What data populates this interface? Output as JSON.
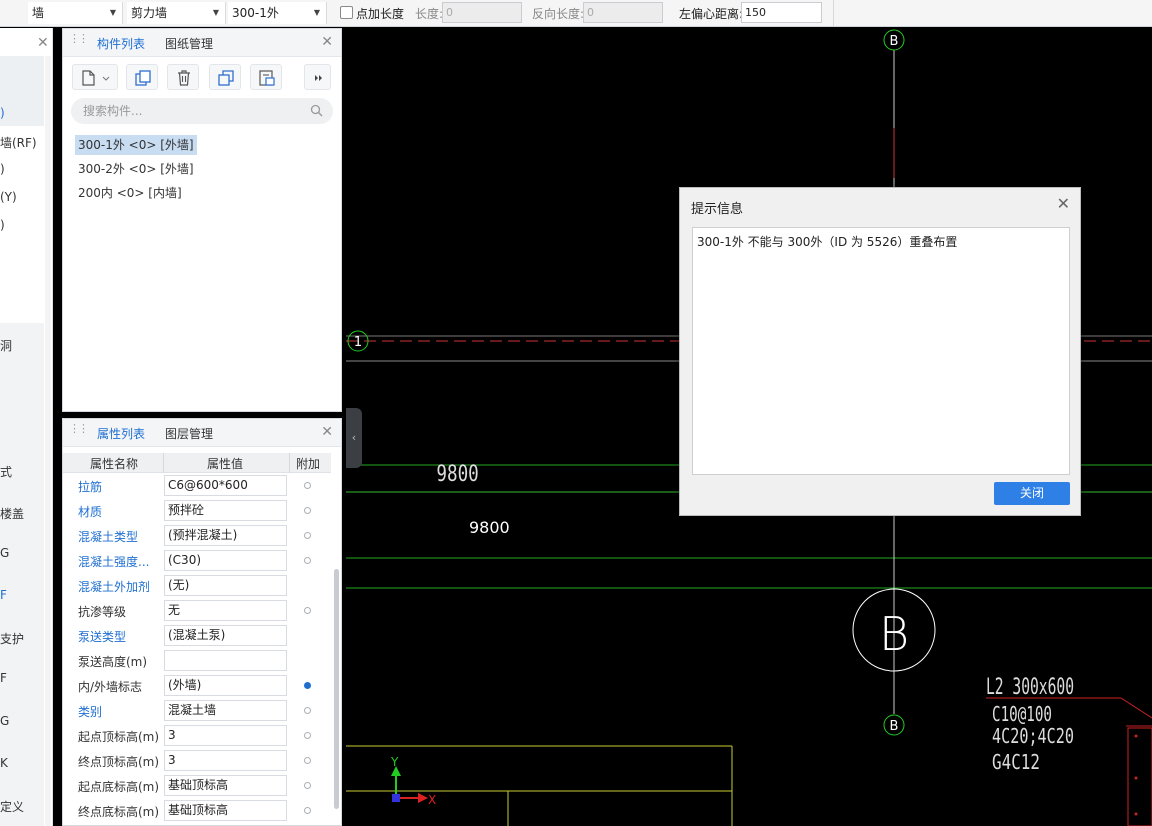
{
  "toolbar": {
    "category": "墙",
    "wall_type": "剪力墙",
    "component": "300-1外",
    "add_length_label": "点加长度",
    "length_label": "长度:",
    "length_value": "0",
    "reverse_length_label": "反向长度:",
    "reverse_length_value": "0",
    "left_offset_label": "左偏心距离:",
    "left_offset_value": "150"
  },
  "left_edge": {
    "items": [
      ")",
      "墙(RF)",
      ")",
      "(Y)",
      ")",
      "洞",
      "式",
      "楼盖",
      "G",
      "F",
      "支护",
      "F",
      "G",
      "K",
      "定义"
    ]
  },
  "component_panel": {
    "tab_list": "构件列表",
    "tab_drawings": "图纸管理",
    "search_placeholder": "搜索构件...",
    "items": [
      "300-1外 <0> [外墙]",
      "300-2外 <0> [外墙]",
      "200内 <0> [内墙]"
    ]
  },
  "property_panel": {
    "tab_props": "属性列表",
    "tab_layers": "图层管理",
    "col_name": "属性名称",
    "col_value": "属性值",
    "col_extra": "附加",
    "rows": [
      {
        "name": "拉筋",
        "value": "C6@600*600"
      },
      {
        "name": "材质",
        "value": "预拌砼"
      },
      {
        "name": "混凝土类型",
        "value": "(预拌混凝土)"
      },
      {
        "name": "混凝土强度...",
        "value": "(C30)"
      },
      {
        "name": "混凝土外加剂",
        "value": "(无)"
      },
      {
        "name": "抗渗等级",
        "value": "无"
      },
      {
        "name": "泵送类型",
        "value": "(混凝土泵)"
      },
      {
        "name": "泵送高度(m)",
        "value": ""
      },
      {
        "name": "内/外墙标志",
        "value": "(外墙)"
      },
      {
        "name": "类别",
        "value": "混凝土墙"
      },
      {
        "name": "起点顶标高(m)",
        "value": "3"
      },
      {
        "name": "终点顶标高(m)",
        "value": "3"
      },
      {
        "name": "起点底标高(m)",
        "value": "基础顶标高"
      },
      {
        "name": "终点底标高(m)",
        "value": "基础顶标高"
      }
    ]
  },
  "canvas": {
    "axis_b_top": "B",
    "axis_b_bottom": "B",
    "axis_b_large": "B",
    "axis_1": "1",
    "dim_cad": "9800",
    "dim_text": "9800",
    "beam_label": "L2 300x600",
    "beam_stirrup": "C10@100",
    "beam_bars": "4C20;4C20",
    "beam_side": "G4C12",
    "ucs_x": "X",
    "ucs_y": "Y"
  },
  "dialog": {
    "title": "提示信息",
    "message": "300-1外 不能与 300外（ID 为 5526）重叠布置",
    "close_button": "关闭"
  }
}
